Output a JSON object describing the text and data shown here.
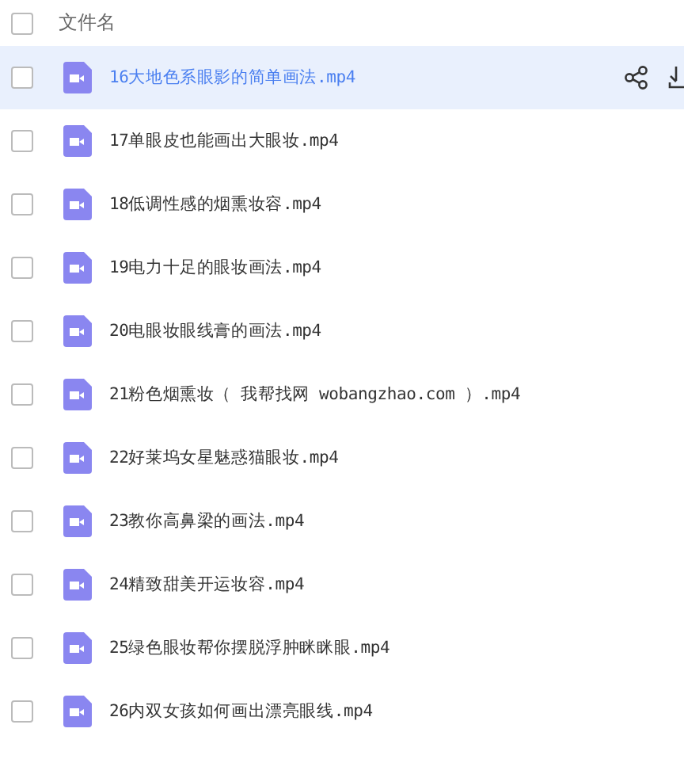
{
  "header": {
    "label": "文件名",
    "checked": false
  },
  "files": [
    {
      "name": "16大地色系眼影的简单画法.mp4",
      "selected": true,
      "checked": false
    },
    {
      "name": "17单眼皮也能画出大眼妆.mp4",
      "selected": false,
      "checked": false
    },
    {
      "name": "18低调性感的烟熏妆容.mp4",
      "selected": false,
      "checked": false
    },
    {
      "name": "19电力十足的眼妆画法.mp4",
      "selected": false,
      "checked": false
    },
    {
      "name": "20电眼妆眼线膏的画法.mp4",
      "selected": false,
      "checked": false
    },
    {
      "name": "21粉色烟熏妆（ 我帮找网 wobangzhao.com ）.mp4",
      "selected": false,
      "checked": false
    },
    {
      "name": "22好莱坞女星魅惑猫眼妆.mp4",
      "selected": false,
      "checked": false
    },
    {
      "name": "23教你高鼻梁的画法.mp4",
      "selected": false,
      "checked": false
    },
    {
      "name": "24精致甜美开运妆容.mp4",
      "selected": false,
      "checked": false
    },
    {
      "name": "25绿色眼妆帮你摆脱浮肿眯眯眼.mp4",
      "selected": false,
      "checked": false
    },
    {
      "name": "26内双女孩如何画出漂亮眼线.mp4",
      "selected": false,
      "checked": false
    }
  ]
}
